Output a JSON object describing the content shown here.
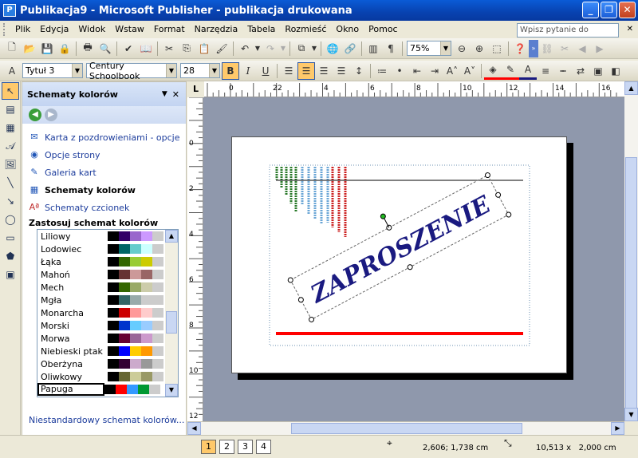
{
  "window": {
    "title": "Publikacja9 - Microsoft Publisher - publikacja drukowana",
    "app_icon": "P"
  },
  "menu": [
    "Plik",
    "Edycja",
    "Widok",
    "Wstaw",
    "Format",
    "Narzędzia",
    "Tabela",
    "Rozmieść",
    "Okno",
    "Pomoc"
  ],
  "help": {
    "placeholder": "Wpisz pytanie do Pomocy"
  },
  "toolbar": {
    "zoom": "75%"
  },
  "format_toolbar": {
    "style": "Tytuł 3",
    "font": "Century Schoolbook",
    "size": "28"
  },
  "pane": {
    "title": "Schematy kolorów",
    "links": [
      {
        "label": "Karta z pozdrowieniami - opcje",
        "icon": "card-icon"
      },
      {
        "label": "Opcje strony",
        "icon": "page-options-icon"
      },
      {
        "label": "Galeria kart",
        "icon": "gallery-icon"
      },
      {
        "label": "Schematy kolorów",
        "icon": "color-scheme-icon"
      },
      {
        "label": "Schematy czcionek",
        "icon": "font-scheme-icon"
      }
    ],
    "section_title": "Zastosuj schemat kolorów",
    "schemes": [
      {
        "name": "Liliowy",
        "colors": [
          "#000000",
          "#330066",
          "#9966cc",
          "#cc99ff",
          "#cccccc"
        ]
      },
      {
        "name": "Lodowiec",
        "colors": [
          "#000000",
          "#006666",
          "#66cccc",
          "#ccffff",
          "#cccccc"
        ]
      },
      {
        "name": "Łąka",
        "colors": [
          "#000000",
          "#336600",
          "#99cc33",
          "#cccc00",
          "#cccccc"
        ]
      },
      {
        "name": "Mahoń",
        "colors": [
          "#000000",
          "#663333",
          "#cc9999",
          "#996666",
          "#cccccc"
        ]
      },
      {
        "name": "Mech",
        "colors": [
          "#000000",
          "#336600",
          "#99aa66",
          "#ccccaa",
          "#cccccc"
        ]
      },
      {
        "name": "Mgła",
        "colors": [
          "#000000",
          "#336666",
          "#99aaaa",
          "#cccccc",
          "#cccccc"
        ]
      },
      {
        "name": "Monarcha",
        "colors": [
          "#000000",
          "#cc0000",
          "#ff9999",
          "#ffcccc",
          "#cccccc"
        ]
      },
      {
        "name": "Morski",
        "colors": [
          "#000000",
          "#0033cc",
          "#66ccff",
          "#99ccff",
          "#cccccc"
        ]
      },
      {
        "name": "Morwa",
        "colors": [
          "#000000",
          "#660033",
          "#996699",
          "#cc99cc",
          "#cccccc"
        ]
      },
      {
        "name": "Niebieski ptak",
        "colors": [
          "#000000",
          "#0000ff",
          "#ffcc00",
          "#ff9900",
          "#cccccc"
        ]
      },
      {
        "name": "Oberżyna",
        "colors": [
          "#000000",
          "#330033",
          "#ccaacc",
          "#999999",
          "#cccccc"
        ]
      },
      {
        "name": "Oliwkowy",
        "colors": [
          "#000000",
          "#666633",
          "#cccc99",
          "#999966",
          "#cccccc"
        ]
      },
      {
        "name": "Papuga",
        "colors": [
          "#000000",
          "#ff0000",
          "#3399ff",
          "#009933",
          "#cccccc"
        ]
      }
    ],
    "selected_scheme": "Papuga",
    "custom_link": "Niestandardowy schemat kolorów..."
  },
  "ruler": {
    "h_labels": [
      "2",
      "0",
      "2",
      "4",
      "6",
      "8",
      "10",
      "12",
      "14",
      "16"
    ],
    "v_labels": [
      "0",
      "2",
      "4",
      "6",
      "8",
      "10",
      "12"
    ]
  },
  "document": {
    "text": "ZAPROSZENIE",
    "text_color": "#1a1a80",
    "line_color": "#ff0000"
  },
  "status": {
    "pages": [
      "1",
      "2",
      "3",
      "4"
    ],
    "current_page": "1",
    "position": "2,606; 1,738 cm",
    "size": "10,513 x   2,000 cm"
  }
}
